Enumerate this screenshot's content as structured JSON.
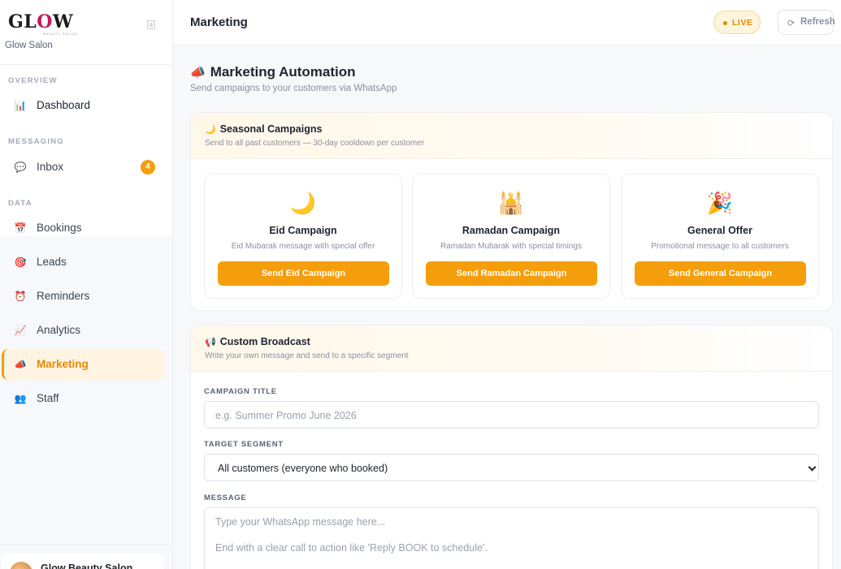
{
  "brand": {
    "logo_left": "GL",
    "logo_o": "O",
    "logo_right": "W",
    "logo_sub": "BEAUTY SALON",
    "name": "Glow Salon"
  },
  "sidebar": {
    "sections": [
      {
        "title": "OVERVIEW"
      },
      {
        "title": "MESSAGING"
      },
      {
        "title": "DATA"
      }
    ],
    "items": [
      {
        "label": "Dashboard",
        "icon": "bar-chart-icon"
      },
      {
        "label": "Inbox",
        "icon": "speech-bubble-icon",
        "badge": "4"
      },
      {
        "label": "Bookings",
        "icon": "calendar-icon"
      },
      {
        "label": "Leads",
        "icon": "target-icon"
      },
      {
        "label": "Reminders",
        "icon": "alarm-clock-icon"
      },
      {
        "label": "Analytics",
        "icon": "line-chart-icon"
      },
      {
        "label": "Marketing",
        "icon": "megaphone-icon",
        "active": true
      },
      {
        "label": "Staff",
        "icon": "people-icon"
      }
    ],
    "profile": {
      "name": "Glow Beauty Salon"
    }
  },
  "topbar": {
    "title": "Marketing",
    "live_label": "LIVE",
    "refresh_label": "Refresh"
  },
  "main": {
    "title": "Marketing Automation",
    "subtitle": "Send campaigns to your customers via WhatsApp"
  },
  "seasonal": {
    "title": "Seasonal Campaigns",
    "subtitle": "Send to all past customers — 30-day cooldown per customer",
    "campaigns": [
      {
        "emoji": "🌙",
        "name": "Eid Campaign",
        "desc": "Eid Mubarak message with special offer",
        "button": "Send Eid Campaign"
      },
      {
        "emoji": "🕌",
        "name": "Ramadan Campaign",
        "desc": "Ramadan Mubarak with special timings",
        "button": "Send Ramadan Campaign"
      },
      {
        "emoji": "🎉",
        "name": "General Offer",
        "desc": "Promotional message to all customers",
        "button": "Send General Campaign"
      }
    ]
  },
  "broadcast": {
    "title": "Custom Broadcast",
    "subtitle": "Write your own message and send to a specific segment",
    "campaign_title_label": "CAMPAIGN TITLE",
    "campaign_title_placeholder": "e.g. Summer Promo June 2026",
    "segment_label": "TARGET SEGMENT",
    "segment_value": "All customers (everyone who booked)",
    "message_label": "MESSAGE",
    "message_placeholder_line1": "Type your WhatsApp message here...",
    "message_placeholder_line2": "End with a clear call to action like 'Reply BOOK to schedule'."
  },
  "colors": {
    "accent": "#f59e0b",
    "accent_text": "#e08a00",
    "active_bg": "#fff4e1"
  }
}
